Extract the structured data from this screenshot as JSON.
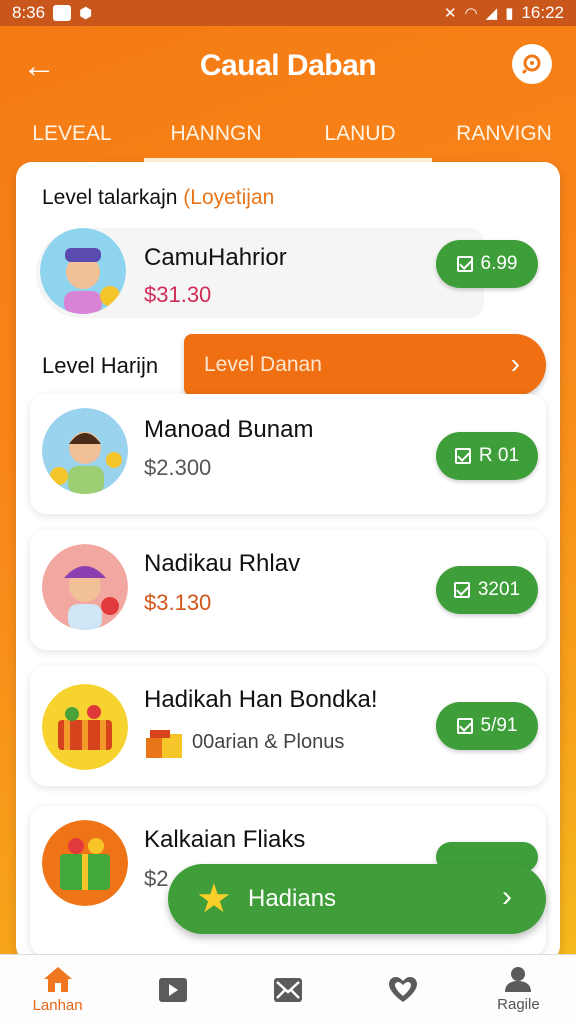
{
  "status_bar": {
    "time_left": "8:36",
    "time_right": "16:22"
  },
  "header": {
    "title": "Caual Daban"
  },
  "tabs": [
    {
      "label": "LEVEAL",
      "active": false
    },
    {
      "label": "HANNGN",
      "active": true
    },
    {
      "label": "LANUD",
      "active": true
    },
    {
      "label": "RANVIGN",
      "active": false
    }
  ],
  "section1": {
    "label": "Level talarkajn",
    "accent": "(Loyetijan"
  },
  "first_item": {
    "name": "CamuHahrior",
    "price": "$31.30",
    "button": "6.99"
  },
  "section2": {
    "label": "Level Harijn",
    "button": "Level Danan"
  },
  "items": [
    {
      "name": "Manoad Bunam",
      "price": "$2.300",
      "button": "R 01"
    },
    {
      "name": "Nadikau Rhlav",
      "price": "$3.130",
      "button": "3201"
    },
    {
      "name": "Hadikah Han Bondka!",
      "price": "00arian & Plonus",
      "button": "5/91"
    },
    {
      "name": "Kalkaian Fliaks",
      "price": "$2",
      "button": ""
    }
  ],
  "cta": {
    "label": "Hadians"
  },
  "bottom_nav": [
    {
      "label": "Lanhan",
      "icon": "home-icon",
      "active": true
    },
    {
      "label": "",
      "icon": "play-icon",
      "active": false
    },
    {
      "label": "",
      "icon": "envelope-icon",
      "active": false
    },
    {
      "label": "",
      "icon": "heart-icon",
      "active": false
    },
    {
      "label": "Ragile",
      "icon": "profile-icon",
      "active": false
    }
  ],
  "colors": {
    "brand_orange": "#f47a14",
    "buy_green": "#3e9f3a",
    "price_red": "#d12c55"
  }
}
